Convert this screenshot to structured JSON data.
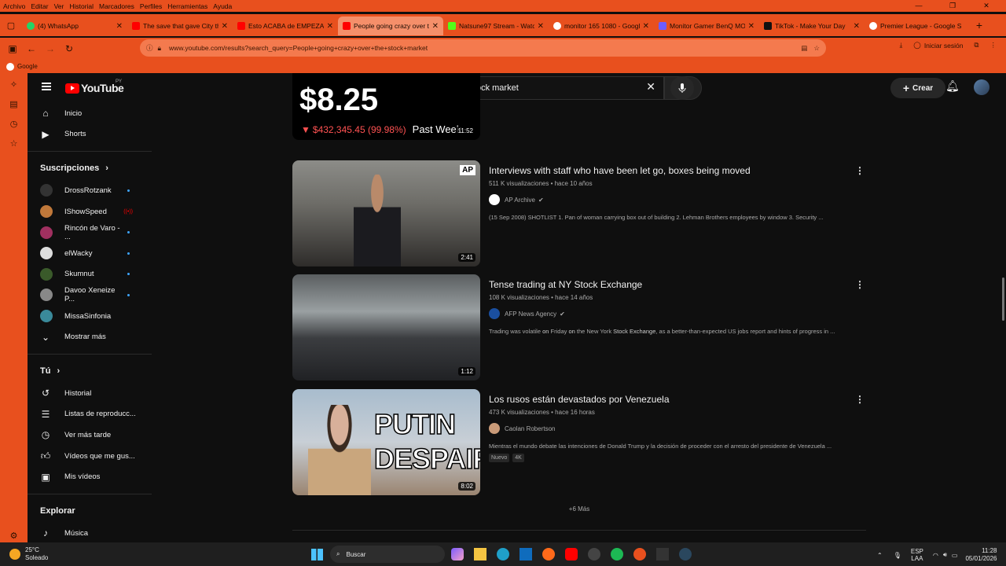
{
  "menubar": [
    "Archivo",
    "Editar",
    "Ver",
    "Historial",
    "Marcadores",
    "Perfiles",
    "Herramientas",
    "Ayuda"
  ],
  "tabs": [
    {
      "label": "(4) WhatsApp",
      "color": "#25d366"
    },
    {
      "label": "The save that gave City the",
      "color": "#ff0000"
    },
    {
      "label": "Esto ACABA de EMPEZAR:",
      "color": "#ff0000"
    },
    {
      "label": "People going crazy over th",
      "color": "#ff0000",
      "active": true
    },
    {
      "label": "Natsune97 Stream - Watch",
      "color": "#53fc18"
    },
    {
      "label": "monitor 165 1080 - Google",
      "color": "#4285f4"
    },
    {
      "label": "Monitor Gamer BenQ MOB",
      "color": "#6e5cff"
    },
    {
      "label": "TikTok - Make Your Day",
      "color": "#111111"
    },
    {
      "label": "Premier League - Google S",
      "color": "#4285f4"
    }
  ],
  "url": "www.youtube.com/results?search_query=People+going+crazy+over+the+stock+market",
  "signin": "Iniciar sesión",
  "bookmark": "Google",
  "yt": {
    "country": "PY",
    "logo": "YouTube",
    "query": "People going crazy over the stock market",
    "create": "Crear"
  },
  "sidebar": {
    "main": [
      {
        "label": "Inicio",
        "icon": "home-icon"
      },
      {
        "label": "Shorts",
        "icon": "shorts-icon"
      }
    ],
    "subs_header": "Suscripciones",
    "subs": [
      {
        "label": "DrossRotzank",
        "color": "#333"
      },
      {
        "label": "IShowSpeed",
        "color": "#c0783a"
      },
      {
        "label": "Rincón de Varo - ...",
        "color": "#a03060"
      },
      {
        "label": "elWacky",
        "color": "#ddd"
      },
      {
        "label": "Skumnut",
        "color": "#3a5a2a"
      },
      {
        "label": "Davoo Xeneize P...",
        "color": "#888"
      },
      {
        "label": "MissaSinfonia",
        "color": "#3a8a9a"
      }
    ],
    "show_more": "Mostrar más",
    "you_header": "Tú",
    "you": [
      {
        "label": "Historial",
        "icon": "history-icon"
      },
      {
        "label": "Listas de reproducc...",
        "icon": "playlist-icon"
      },
      {
        "label": "Ver más tarde",
        "icon": "clock-icon"
      },
      {
        "label": "Vídeos que me gus...",
        "icon": "like-icon"
      },
      {
        "label": "Mis vídeos",
        "icon": "my-videos-icon"
      }
    ],
    "explore_header": "Explorar",
    "explore": [
      {
        "label": "Música",
        "icon": "music-icon"
      }
    ]
  },
  "videos": [
    {
      "price": "$8.25",
      "change": "$432,345.45 (99.98%)",
      "period": "Past Week",
      "duration": "11:52"
    },
    {
      "title": "Interviews with staff who have been let go, boxes being moved",
      "meta": "511 K visualizaciones • hace 10 años",
      "channel": "AP Archive",
      "desc": "(15 Sep 2008) SHOTLIST 1. Pan of woman carrying box out of building 2. Lehman Brothers employees by window 3. Security ...",
      "duration": "2:41",
      "badge": "AP"
    },
    {
      "title": "Tense trading at NY Stock Exchange",
      "meta": "108 K visualizaciones • hace 14 años",
      "channel": "AFP News Agency",
      "desc_parts": [
        "Trading was volatile ",
        "on",
        " Friday ",
        "on",
        " the New York ",
        "Stock Exchange",
        ", as a better-than-expected US jobs report and hints of progress in ..."
      ],
      "duration": "1:12"
    },
    {
      "title": "Los rusos están devastados por Venezuela",
      "meta": "473 K visualizaciones • hace 16 horas",
      "channel": "Caolan Robertson",
      "desc": "Mientras el mundo debate las intenciones de Donald Trump y la decisión de proceder con el arresto del presidente de Venezuela ...",
      "duration": "8:02",
      "thumb_text1": "PUTIN",
      "thumb_text2": "DESPAIR",
      "badges": [
        "Nuevo",
        "4K"
      ]
    }
  ],
  "more": "+6 Más",
  "taskbar": {
    "temp": "25°C",
    "weather": "Soleado",
    "search": "Buscar",
    "lang1": "ESP",
    "lang2": "LAA",
    "time": "11:28",
    "date": "05/01/2026"
  }
}
